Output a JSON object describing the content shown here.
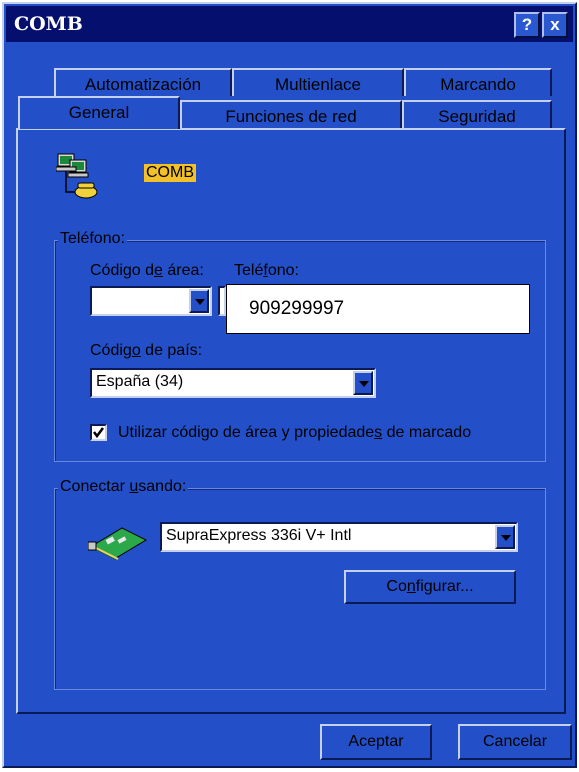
{
  "window": {
    "title": "COMB",
    "help_button": "?",
    "close_button": "x"
  },
  "tabs": {
    "row_back": [
      "Automatización",
      "Multienlace",
      "Marcando"
    ],
    "row_front": [
      "General",
      "Funciones de red",
      "Seguridad"
    ],
    "active": "General"
  },
  "connection": {
    "name": "COMB",
    "icon": "dial-up-network-icon"
  },
  "phone_group": {
    "label": "Teléfono:",
    "area_code_label_a": "Código d",
    "area_code_label_u": "e",
    "area_code_label_b": " área:",
    "area_code_value": "",
    "phone_label_a": "Telé",
    "phone_label_u": "f",
    "phone_label_b": "ono:",
    "phone_value": "909299997",
    "country_label_a": "Códig",
    "country_label_u": "o",
    "country_label_b": " de país:",
    "country_value": "España (34)",
    "checkbox_checked": true,
    "checkbox_label_a": "Utilizar código de área y propiedade",
    "checkbox_label_u": "s",
    "checkbox_label_b": " de marcado"
  },
  "connect_group": {
    "label_a": "Conectar ",
    "label_u": "u",
    "label_b": "sando:",
    "modem": "SupraExpress 336i V+ Intl",
    "modem_icon": "modem-card-icon",
    "configure_a": "Co",
    "configure_u": "n",
    "configure_b": "figurar..."
  },
  "footer": {
    "ok": "Aceptar",
    "cancel": "Cancelar"
  }
}
